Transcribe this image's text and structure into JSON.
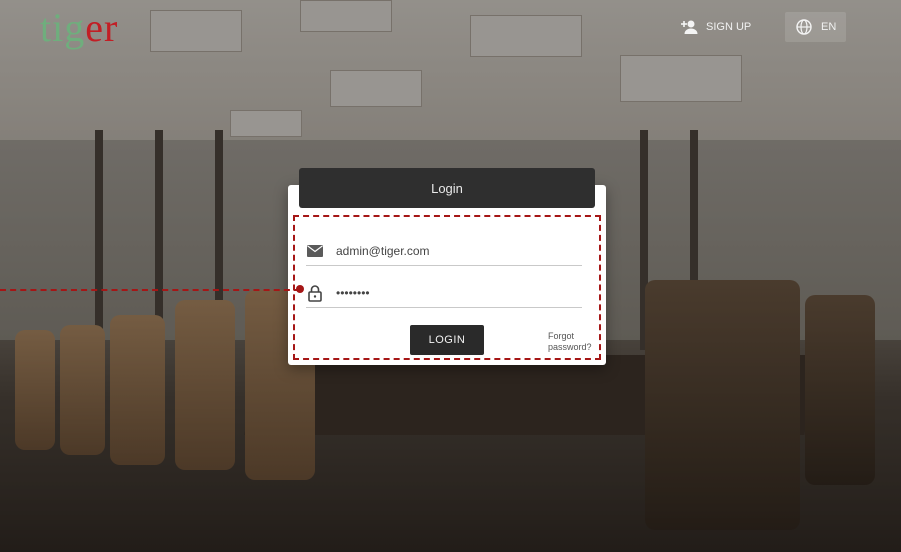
{
  "header": {
    "logo_part1": "tig",
    "logo_part2": "er",
    "signup_label": "SIGN UP",
    "language_label": "EN",
    "signup_icon": "add-user-icon",
    "language_icon": "globe-icon"
  },
  "login_card": {
    "title": "Login",
    "email_value": "admin@tiger.com",
    "email_icon": "envelope-icon",
    "password_value": "••••••••",
    "password_icon": "lock-icon",
    "login_button": "LOGIN",
    "forgot_link": "Forgot password?"
  },
  "colors": {
    "accent_dark": "#2f2f2f",
    "highlight_dashed": "#a51616",
    "logo_green": "#6fae7d",
    "logo_red": "#c21e25"
  }
}
